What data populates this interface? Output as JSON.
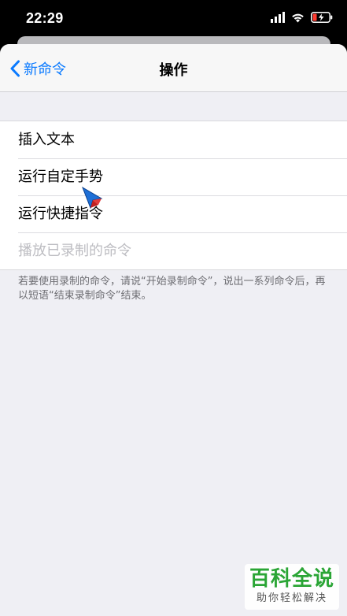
{
  "status_bar": {
    "time": "22:29"
  },
  "nav": {
    "back_label": "新命令",
    "title": "操作"
  },
  "list": {
    "items": [
      {
        "label": "插入文本",
        "enabled": true
      },
      {
        "label": "运行自定手势",
        "enabled": true
      },
      {
        "label": "运行快捷指令",
        "enabled": true
      },
      {
        "label": "播放已录制的命令",
        "enabled": false
      }
    ]
  },
  "footer_note": "若要使用录制的命令，请说“开始录制命令”，说出一系列命令后，再以短语“结束录制命令”结束。",
  "watermark": {
    "main": "百科全说",
    "sub": "助你轻松解决"
  },
  "colors": {
    "accent": "#0a7aff",
    "background": "#efeff4",
    "disabled_text": "#bdbdc2",
    "watermark_green": "#2aa535"
  },
  "icons": [
    "chevron-left-icon",
    "signal-icon",
    "wifi-icon",
    "battery-charging-icon",
    "pointer-cursor-icon"
  ]
}
